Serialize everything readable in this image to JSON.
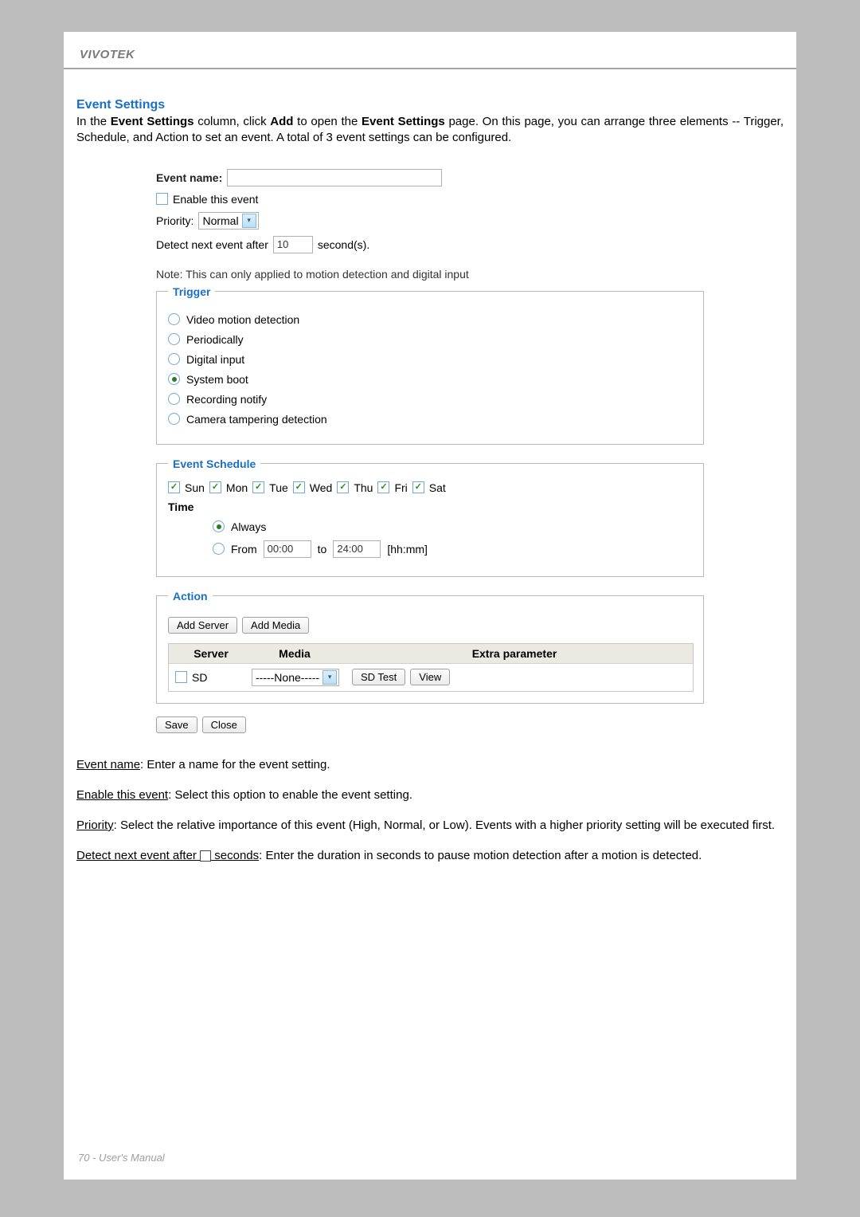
{
  "brand": "VIVOTEK",
  "section_title": "Event Settings",
  "intro": {
    "pre": "In the ",
    "b1": "Event Settings",
    "mid1": " column, click ",
    "b2": "Add",
    "mid2": " to open the ",
    "b3": "Event Settings",
    "post": " page. On this page, you can arrange three elements -- Trigger, Schedule, and Action to set an event. A total of 3 event settings can be configured."
  },
  "form": {
    "event_name_label": "Event name:",
    "event_name_value": "",
    "enable_label": "Enable this event",
    "priority_label": "Priority:",
    "priority_value": "Normal",
    "detect_pre": "Detect next event after",
    "detect_value": "10",
    "detect_post": "second(s).",
    "note": "Note: This can only applied to motion detection and digital input"
  },
  "trigger": {
    "legend": "Trigger",
    "options": {
      "video_motion": "Video motion detection",
      "periodically": "Periodically",
      "digital_input": "Digital input",
      "system_boot": "System boot",
      "recording_notify": "Recording notify",
      "camera_tampering": "Camera tampering detection"
    }
  },
  "schedule": {
    "legend": "Event Schedule",
    "days": {
      "sun": "Sun",
      "mon": "Mon",
      "tue": "Tue",
      "wed": "Wed",
      "thu": "Thu",
      "fri": "Fri",
      "sat": "Sat"
    },
    "time_label": "Time",
    "always": "Always",
    "from_label": "From",
    "from_value": "00:00",
    "to_label": "to",
    "to_value": "24:00",
    "format": "[hh:mm]"
  },
  "action": {
    "legend": "Action",
    "add_server": "Add Server",
    "add_media": "Add Media",
    "headers": {
      "server": "Server",
      "media": "Media",
      "extra": "Extra parameter"
    },
    "row": {
      "sd_label": "SD",
      "media_value": "-----None-----",
      "sd_test": "SD Test",
      "view": "View"
    }
  },
  "buttons": {
    "save": "Save",
    "close": "Close"
  },
  "explain": {
    "p1": {
      "u": "Event name",
      "rest": ": Enter a name for the event setting."
    },
    "p2": {
      "u": "Enable this event",
      "rest": ": Select this option to enable the event setting."
    },
    "p3": {
      "u": "Priority",
      "rest": ": Select the relative importance of this event (High, Normal, or Low). Events with a higher priority setting will be executed first."
    },
    "p4": {
      "u1": "Detect next event after ",
      "u2": " seconds",
      "rest": ": Enter the duration in seconds to pause motion detection after a motion is detected."
    }
  },
  "footer": "70 - User's Manual"
}
